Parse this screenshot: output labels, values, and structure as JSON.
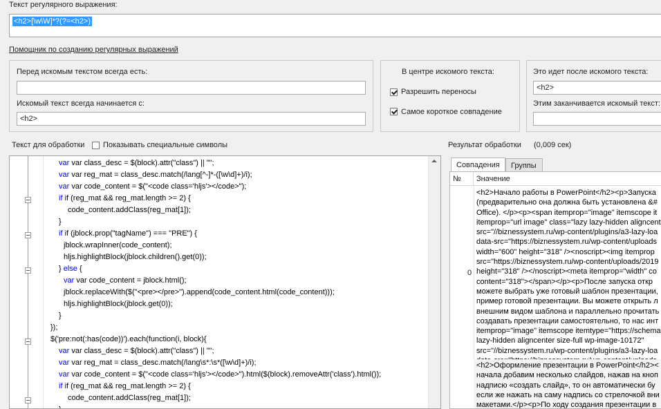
{
  "regex": {
    "label": "Текст регулярного выражения:",
    "value": "<h2>[\\w\\W]*?(?=<h2>)"
  },
  "helper_link": "Помощник по созданию регулярных выражений",
  "before_group": {
    "always_before_label": "Перед искомым текстом всегда есть:",
    "always_before_value": "",
    "starts_with_label": "Искомый текст всегда начинается с:",
    "starts_with_value": "<h2>"
  },
  "center_group": {
    "title": "В центре искомого текста:",
    "allow_linebreaks_label": "Разрешить переносы",
    "allow_linebreaks_checked": true,
    "shortest_match_label": "Самое короткое совпадение",
    "shortest_match_checked": true
  },
  "after_group": {
    "after_label": "Это идет после искомого текста:",
    "after_value": "<h2>",
    "ends_with_label": "Этим заканчивается искомый текст:",
    "ends_with_value": ""
  },
  "text_section": {
    "label": "Текст для обработки",
    "show_special_label": "Показывать специальные символы",
    "show_special_checked": false
  },
  "code_lines": [
    "var class_desc = $(block).attr(\"class\") || \"\";",
    "var reg_mat = class_desc.match(/lang[^-]*-([\\w\\d]+)/i);",
    "var code_content = $(\"<code class='hljs'></code>\");",
    "if (reg_mat && reg_mat.length >= 2) {",
    "code_content.addClass(reg_mat[1]);",
    "}",
    "if (jblock.prop(\"tagName\") === \"PRE\") {",
    "jblock.wrapInner(code_content);",
    "hljs.highlightBlock(jblock.children().get(0));",
    "} else {",
    "var code_content = jblock.html();",
    "jblock.replaceWith($(\"<pre></pre>\").append(code_content.html(code_content)));",
    "hljs.highlightBlock(jblock.get(0));",
    "}",
    "});",
    "$('pre:not(:has(code))').each(function(i, block){",
    "var class_desc = $(block).attr(\"class\") || \"\";",
    "var reg_mat = class_desc.match(/lang\\s*:\\s*([\\w\\d]+)/i);",
    "var code_content = $(\"<code class='hljs'></code>\").html($(block).removeAttr('class').html());",
    "if (reg_mat && reg_mat.length >= 2) {",
    "code_content.addClass(reg_mat[1]);",
    "}"
  ],
  "result": {
    "label": "Результат обработки",
    "time": "(0,009 сек)",
    "tabs": [
      "Совпадения",
      "Группы"
    ],
    "columns": [
      "№",
      "Значение"
    ],
    "rows": [
      {
        "num": "0",
        "text": [
          "<h2>Начало работы в PowerPoint</h2><p>Запуска",
          "(предварительно она должна быть установлена &#",
          "Office). </p><p><span itemprop=\"image\" itemscope it",
          "itemprop=\"url image\" class=\"lazy lazy-hidden aligncente",
          "src=\"//biznessystem.ru/wp-content/plugins/a3-lazy-loa",
          "data-src=\"https://biznessystem.ru/wp-content/uploads",
          "width=\"600\" height=\"318\" /><noscript><img itemprop",
          "src=\"https://biznessystem.ru/wp-content/uploads/2019",
          "height=\"318\" /></noscript><meta itemprop=\"width\" co",
          "content=\"318\"></span></p><p>После запуска откр",
          "можете выбрать уже готовый шаблон презентации,",
          "пример готовой презентации. Вы можете открыть л",
          "внешним видом шаблона и параллельно прочитать и",
          "создавать презентации самостоятельно, то нас инт",
          "itemprop=\"image\" itemscope itemtype=\"https://schema",
          "lazy-hidden aligncenter size-full wp-image-10172\"",
          "src=\"//biznessystem.ru/wp-content/plugins/a3-lazy-loa",
          "data-src=\"https://biznessystem.ru/wp-content/uploads",
          "height=\"319\" /><noscript><img itemprop=\"url image\" c"
        ]
      },
      {
        "num": "",
        "text": [
          "<h2>Оформление презентации в PowerPoint</h2><",
          "начала добавим несколько слайдов, нажав на кноп",
          "надписю «создать слайд», то он автоматически бу",
          "если же нажать на саму надпись со стрелочкой вни",
          "макетами.</p><p>По ходу создания презентации в",
          "можете поменять и его структуру. Щелкнув прав"
        ]
      }
    ]
  }
}
